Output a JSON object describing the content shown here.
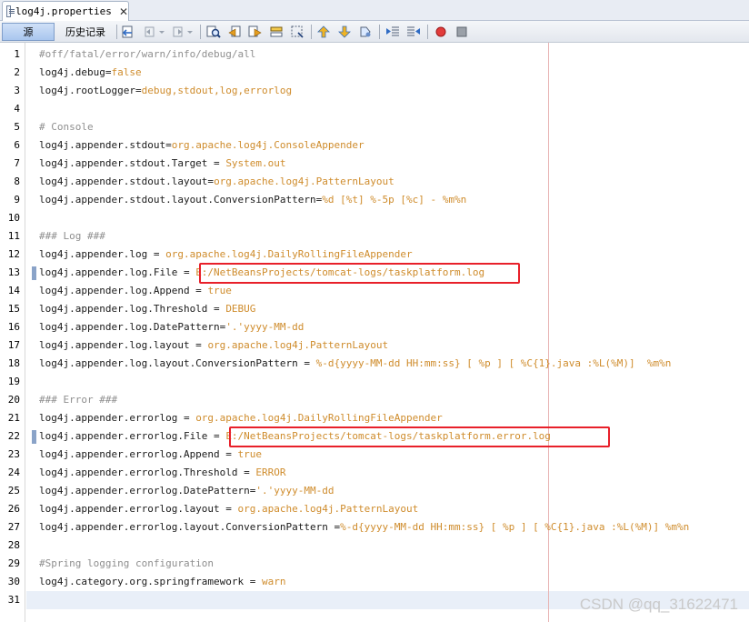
{
  "tab": {
    "title": "log4j.properties",
    "close_glyph": "✕"
  },
  "toolbar": {
    "source_label": "源",
    "history_label": "历史记录",
    "icons": [
      "last-edit-icon",
      "back-icon",
      "forward-icon",
      "find-icon",
      "find-previous-icon",
      "find-next-icon",
      "toggle-highlight-icon",
      "find-selection-icon",
      "previous-bookmark-icon",
      "next-bookmark-icon",
      "toggle-bookmark-icon",
      "shift-left-icon",
      "shift-right-icon",
      "record-macro-icon",
      "stop-macro-icon"
    ]
  },
  "lines": [
    {
      "n": "1",
      "parts": [
        {
          "t": "#off/fatal/error/warn/info/debug/all",
          "c": "c"
        }
      ]
    },
    {
      "n": "2",
      "parts": [
        {
          "t": "log4j.debug=",
          "c": "k"
        },
        {
          "t": "false",
          "c": "v"
        }
      ]
    },
    {
      "n": "3",
      "parts": [
        {
          "t": "log4j.rootLogger=",
          "c": "k"
        },
        {
          "t": "debug,stdout,log,errorlog",
          "c": "v"
        }
      ]
    },
    {
      "n": "4",
      "parts": []
    },
    {
      "n": "5",
      "parts": [
        {
          "t": "# Console",
          "c": "c"
        }
      ]
    },
    {
      "n": "6",
      "parts": [
        {
          "t": "log4j.appender.stdout=",
          "c": "k"
        },
        {
          "t": "org.apache.log4j.ConsoleAppender",
          "c": "v"
        }
      ]
    },
    {
      "n": "7",
      "parts": [
        {
          "t": "log4j.appender.stdout.Target = ",
          "c": "k"
        },
        {
          "t": "System.out",
          "c": "v"
        }
      ]
    },
    {
      "n": "8",
      "parts": [
        {
          "t": "log4j.appender.stdout.layout=",
          "c": "k"
        },
        {
          "t": "org.apache.log4j.PatternLayout",
          "c": "v"
        }
      ]
    },
    {
      "n": "9",
      "parts": [
        {
          "t": "log4j.appender.stdout.layout.ConversionPattern=",
          "c": "k"
        },
        {
          "t": "%d [%t] %-5p [%c] - %m%n",
          "c": "v"
        }
      ]
    },
    {
      "n": "10",
      "parts": []
    },
    {
      "n": "11",
      "parts": [
        {
          "t": "### Log ###",
          "c": "c"
        }
      ]
    },
    {
      "n": "12",
      "parts": [
        {
          "t": "log4j.appender.log = ",
          "c": "k"
        },
        {
          "t": "org.apache.log4j.DailyRollingFileAppender",
          "c": "v"
        }
      ]
    },
    {
      "n": "13",
      "parts": [
        {
          "t": "log4j.appender.log.File = ",
          "c": "k"
        },
        {
          "t": "E:/NetBeansProjects/tomcat-logs/taskplatform.log",
          "c": "v"
        }
      ],
      "mark": true
    },
    {
      "n": "14",
      "parts": [
        {
          "t": "log4j.appender.log.Append = ",
          "c": "k"
        },
        {
          "t": "true",
          "c": "v"
        }
      ]
    },
    {
      "n": "15",
      "parts": [
        {
          "t": "log4j.appender.log.Threshold = ",
          "c": "k"
        },
        {
          "t": "DEBUG",
          "c": "v"
        }
      ]
    },
    {
      "n": "16",
      "parts": [
        {
          "t": "log4j.appender.log.DatePattern=",
          "c": "k"
        },
        {
          "t": "'.'yyyy-MM-dd",
          "c": "v"
        }
      ]
    },
    {
      "n": "17",
      "parts": [
        {
          "t": "log4j.appender.log.layout = ",
          "c": "k"
        },
        {
          "t": "org.apache.log4j.PatternLayout",
          "c": "v"
        }
      ]
    },
    {
      "n": "18",
      "parts": [
        {
          "t": "log4j.appender.log.layout.ConversionPattern = ",
          "c": "k"
        },
        {
          "t": "%-d{yyyy-MM-dd HH:mm:ss} [ %p ] [ %C{1}.java :%L(%M)]  %m%n",
          "c": "v"
        }
      ]
    },
    {
      "n": "19",
      "parts": []
    },
    {
      "n": "20",
      "parts": [
        {
          "t": "### Error ###",
          "c": "c"
        }
      ]
    },
    {
      "n": "21",
      "parts": [
        {
          "t": "log4j.appender.errorlog = ",
          "c": "k"
        },
        {
          "t": "org.apache.log4j.DailyRollingFileAppender",
          "c": "v"
        }
      ]
    },
    {
      "n": "22",
      "parts": [
        {
          "t": "log4j.appender.errorlog.File = ",
          "c": "k"
        },
        {
          "t": "E:/NetBeansProjects/tomcat-logs/taskplatform.error.log",
          "c": "v"
        }
      ],
      "mark": true
    },
    {
      "n": "23",
      "parts": [
        {
          "t": "log4j.appender.errorlog.Append = ",
          "c": "k"
        },
        {
          "t": "true",
          "c": "v"
        }
      ]
    },
    {
      "n": "24",
      "parts": [
        {
          "t": "log4j.appender.errorlog.Threshold = ",
          "c": "k"
        },
        {
          "t": "ERROR",
          "c": "v"
        }
      ]
    },
    {
      "n": "25",
      "parts": [
        {
          "t": "log4j.appender.errorlog.DatePattern=",
          "c": "k"
        },
        {
          "t": "'.'yyyy-MM-dd",
          "c": "v"
        }
      ]
    },
    {
      "n": "26",
      "parts": [
        {
          "t": "log4j.appender.errorlog.layout = ",
          "c": "k"
        },
        {
          "t": "org.apache.log4j.PatternLayout",
          "c": "v"
        }
      ]
    },
    {
      "n": "27",
      "parts": [
        {
          "t": "log4j.appender.errorlog.layout.ConversionPattern =",
          "c": "k"
        },
        {
          "t": "%-d{yyyy-MM-dd HH:mm:ss} [ %p ] [ %C{1}.java :%L(%M)] %m%n",
          "c": "v"
        }
      ]
    },
    {
      "n": "28",
      "parts": []
    },
    {
      "n": "29",
      "parts": [
        {
          "t": "#Spring logging configuration",
          "c": "c"
        }
      ]
    },
    {
      "n": "30",
      "parts": [
        {
          "t": "log4j.category.org.springframework = ",
          "c": "k"
        },
        {
          "t": "warn",
          "c": "v"
        }
      ]
    },
    {
      "n": "31",
      "parts": []
    }
  ],
  "watermark": "CSDN @qq_31622471",
  "colors": {
    "value": "#cf8c2c",
    "comment": "#8f8f8f",
    "highlight_box": "#e8202a",
    "current_line": "#e9eff8"
  }
}
